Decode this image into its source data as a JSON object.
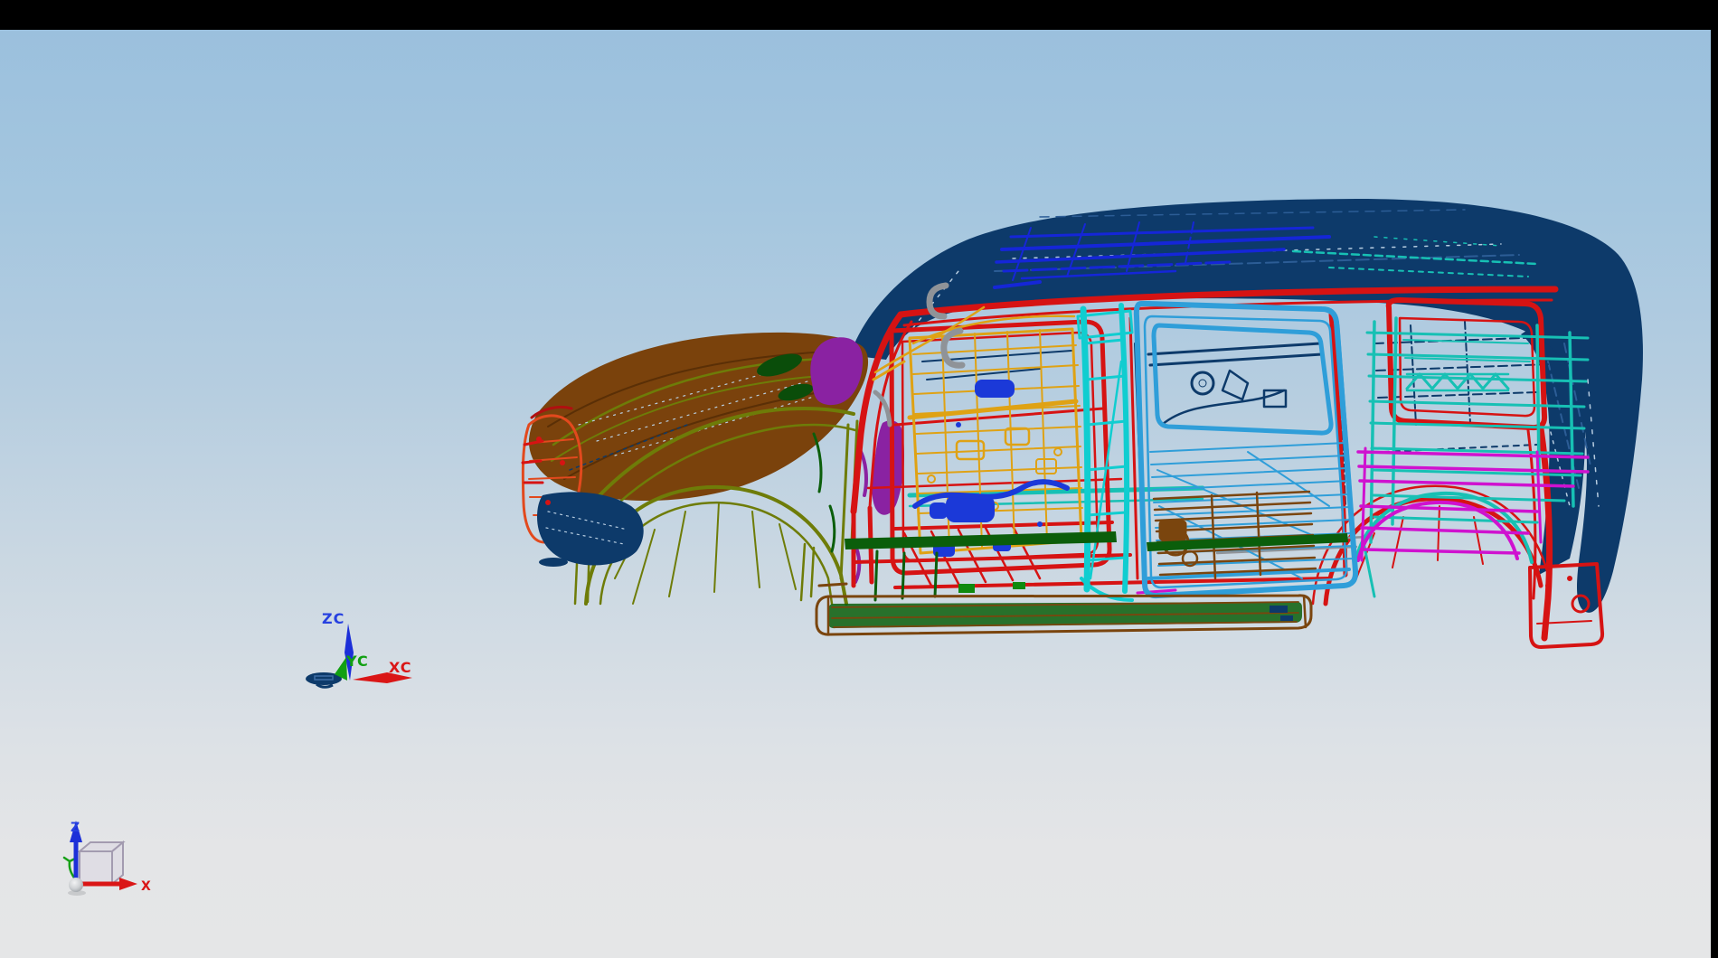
{
  "window": {
    "top_bar_color": "#000000",
    "side_bar_color": "#000000"
  },
  "viewport": {
    "background_top": "#9bc0dd",
    "background_bottom": "#e5e6e7",
    "content": "CAD wireframe side view of an SUV body-in-white assembly"
  },
  "wcs_triad": {
    "z_label": "ZC",
    "y_label": "YC",
    "x_label": "XC",
    "z_color": "#2741e0",
    "y_color": "#12a012",
    "x_color": "#da1616"
  },
  "view_triad": {
    "z_label": "Z",
    "x_label": "X",
    "z_color": "#2741e0",
    "x_color": "#da1616",
    "cube_face": "#dcd8e2",
    "cube_edge": "#a39bb0"
  },
  "model": {
    "part_colors": {
      "roof_outer": "#0d3a6a",
      "roof_bows": "#1526d8",
      "frame_red": "#d61313",
      "front_lamp_parts": "#e2491d",
      "hood": "#7a420c",
      "front_fender": "#6e7c08",
      "front_door_inner": "#dfa214",
      "b_pillar": "#10cdd0",
      "quarter_structure": "#17c0b4",
      "rear_door": "#2f9ed9",
      "rear_quarter_lower": "#cf12cf",
      "sill_strip": "#0b5e0b",
      "running_board": "#7a450e",
      "cowl_parts": "#8a22a2",
      "handles": "#8f9398",
      "interior_blue": "#1b39d8",
      "origin_disk": "#0d3a6a"
    }
  }
}
